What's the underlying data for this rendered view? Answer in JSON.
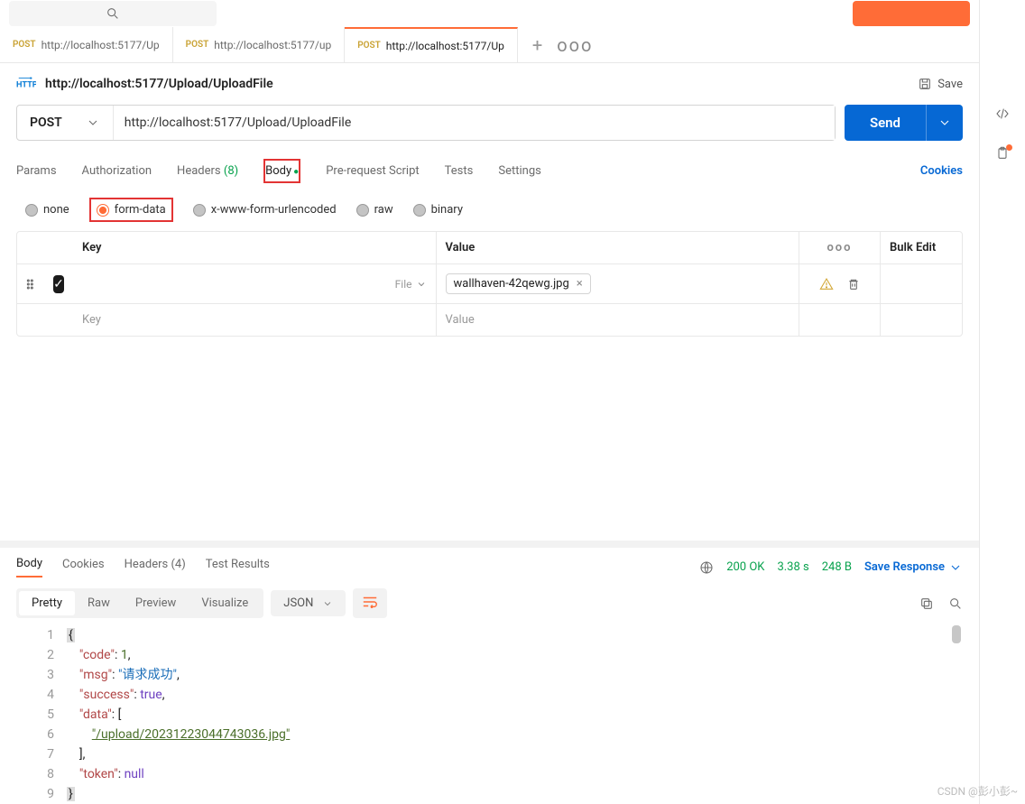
{
  "topbar": {
    "orange_btn": ""
  },
  "tabs": [
    {
      "method": "POST",
      "title": "http://localhost:5177/Up"
    },
    {
      "method": "POST",
      "title": "http://localhost:5177/up"
    },
    {
      "method": "POST",
      "title": "http://localhost:5177/Up",
      "active": true
    }
  ],
  "tab_actions": {
    "add": "+",
    "more": "ooo"
  },
  "request": {
    "http_badge": "HTTP",
    "title": "http://localhost:5177/Upload/UploadFile",
    "save_label": "Save",
    "method": "POST",
    "url": "http://localhost:5177/Upload/UploadFile",
    "send_label": "Send"
  },
  "req_tabs": {
    "params": "Params",
    "auth": "Authorization",
    "headers_label": "Headers",
    "headers_count": "(8)",
    "body": "Body",
    "prereq": "Pre-request Script",
    "tests": "Tests",
    "settings": "Settings",
    "cookies": "Cookies"
  },
  "body_types": {
    "none": "none",
    "form_data": "form-data",
    "xwww": "x-www-form-urlencoded",
    "raw": "raw",
    "binary": "binary"
  },
  "kv": {
    "header_key": "Key",
    "header_value": "Value",
    "header_bulk": "Bulk Edit",
    "more": "ooo",
    "file_type": "File",
    "file_chip": "wallhaven-42qewg.jpg",
    "file_remove": "×",
    "placeholder_key": "Key",
    "placeholder_value": "Value"
  },
  "response": {
    "tabs": {
      "body": "Body",
      "cookies": "Cookies",
      "headers_label": "Headers",
      "headers_count": "(4)",
      "tests": "Test Results"
    },
    "status_code": "200 OK",
    "time": "3.38 s",
    "size": "248 B",
    "save_label": "Save Response",
    "view": {
      "pretty": "Pretty",
      "raw": "Raw",
      "preview": "Preview",
      "visualize": "Visualize"
    },
    "format": "JSON",
    "json_lines": {
      "l1": "{",
      "l2_k": "\"code\"",
      "l2_v": "1",
      "l3_k": "\"msg\"",
      "l3_v": "\"请求成功\"",
      "l4_k": "\"success\"",
      "l4_v": "true",
      "l5_k": "\"data\"",
      "l5_b": "[",
      "l6_v": "\"/upload/20231223044743036.jpg\"",
      "l7": "],",
      "l8_k": "\"token\"",
      "l8_v": "null",
      "l9": "}"
    },
    "gutter": [
      "1",
      "2",
      "3",
      "4",
      "5",
      "6",
      "7",
      "8",
      "9"
    ]
  },
  "watermark": "CSDN @彭小彭~"
}
